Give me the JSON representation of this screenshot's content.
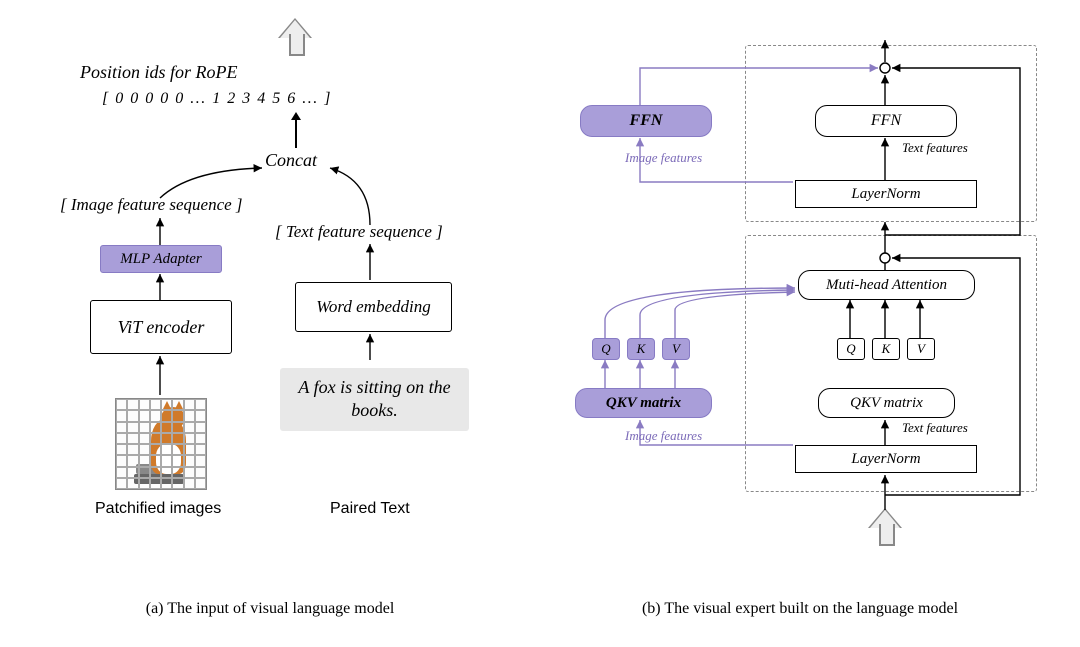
{
  "panel_a": {
    "caption": "(a) The input of visual language model",
    "rope_label": "Position ids for RoPE",
    "rope_ids": "[  0  0  0  0  0  ...  1  2  3  4  5  6  ... ]",
    "concat": "Concat",
    "image_feature_seq": "[ Image feature sequence ]",
    "text_feature_seq": "[ Text  feature sequence ]",
    "mlp_adapter": "MLP Adapter",
    "vit_encoder": "ViT encoder",
    "word_embedding": "Word embedding",
    "sample_text": "A fox is sitting on the books.",
    "patchified_label": "Patchified images",
    "paired_label": "Paired Text"
  },
  "panel_b": {
    "caption": "(b) The visual expert built on the language model",
    "ffn_visual": "FFN",
    "ffn_text": "FFN",
    "layernorm": "LayerNorm",
    "attention": "Muti-head Attention",
    "qkv_visual": "QKV matrix",
    "qkv_text": "QKV matrix",
    "q": "Q",
    "k": "K",
    "v": "V",
    "image_features": "Image features",
    "text_features": "Text features"
  }
}
